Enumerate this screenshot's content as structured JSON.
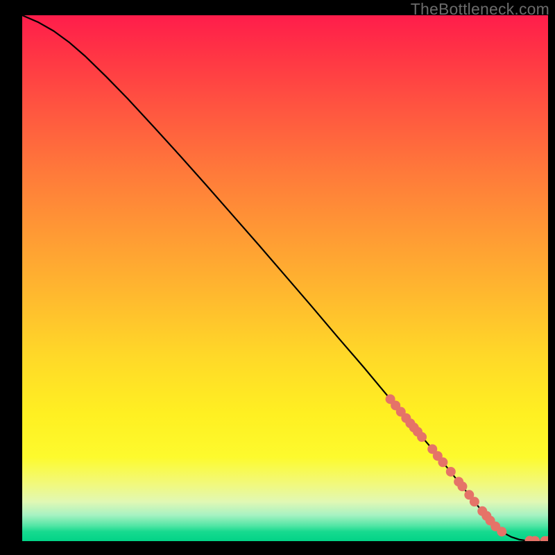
{
  "watermark": "TheBottleneck.com",
  "colors": {
    "line": "#000000",
    "marker_fill": "#e57368",
    "marker_stroke": "#c85a50",
    "background_black": "#000000"
  },
  "chart_data": {
    "type": "line",
    "title": "",
    "xlabel": "",
    "ylabel": "",
    "xlim": [
      0,
      100
    ],
    "ylim": [
      0,
      100
    ],
    "grid": false,
    "legend": false,
    "series": [
      {
        "name": "curve",
        "x": [
          0,
          3,
          6,
          9,
          12,
          16,
          20,
          25,
          30,
          35,
          40,
          45,
          50,
          55,
          60,
          65,
          70,
          73,
          75,
          78,
          80,
          82,
          84,
          86,
          88,
          90,
          91.5,
          93,
          94.5,
          95.5,
          96.5,
          98,
          99.5,
          100
        ],
        "y": [
          100,
          98.7,
          97.0,
          94.8,
          92.2,
          88.3,
          84.2,
          78.8,
          73.3,
          67.7,
          62.0,
          56.3,
          50.5,
          44.7,
          38.8,
          33.0,
          27.0,
          23.5,
          21.0,
          17.5,
          15.0,
          12.5,
          10.0,
          7.5,
          5.0,
          2.8,
          1.6,
          0.8,
          0.3,
          0.15,
          0.08,
          0.04,
          0.03,
          0.03
        ]
      }
    ],
    "markers": {
      "name": "highlighted-points",
      "x": [
        70,
        71,
        72,
        73,
        73.8,
        74.5,
        75.2,
        76,
        78,
        79,
        80,
        81.5,
        83,
        83.7,
        85,
        86,
        87.5,
        88.3,
        89,
        90,
        91.2,
        96.5,
        97.5,
        99.4,
        100
      ],
      "y": [
        27.0,
        25.8,
        24.6,
        23.4,
        22.4,
        21.6,
        20.8,
        19.8,
        17.5,
        16.2,
        15.0,
        13.2,
        11.3,
        10.4,
        8.8,
        7.5,
        5.7,
        4.8,
        3.9,
        2.8,
        1.8,
        0.08,
        0.05,
        0.03,
        0.03
      ]
    }
  }
}
